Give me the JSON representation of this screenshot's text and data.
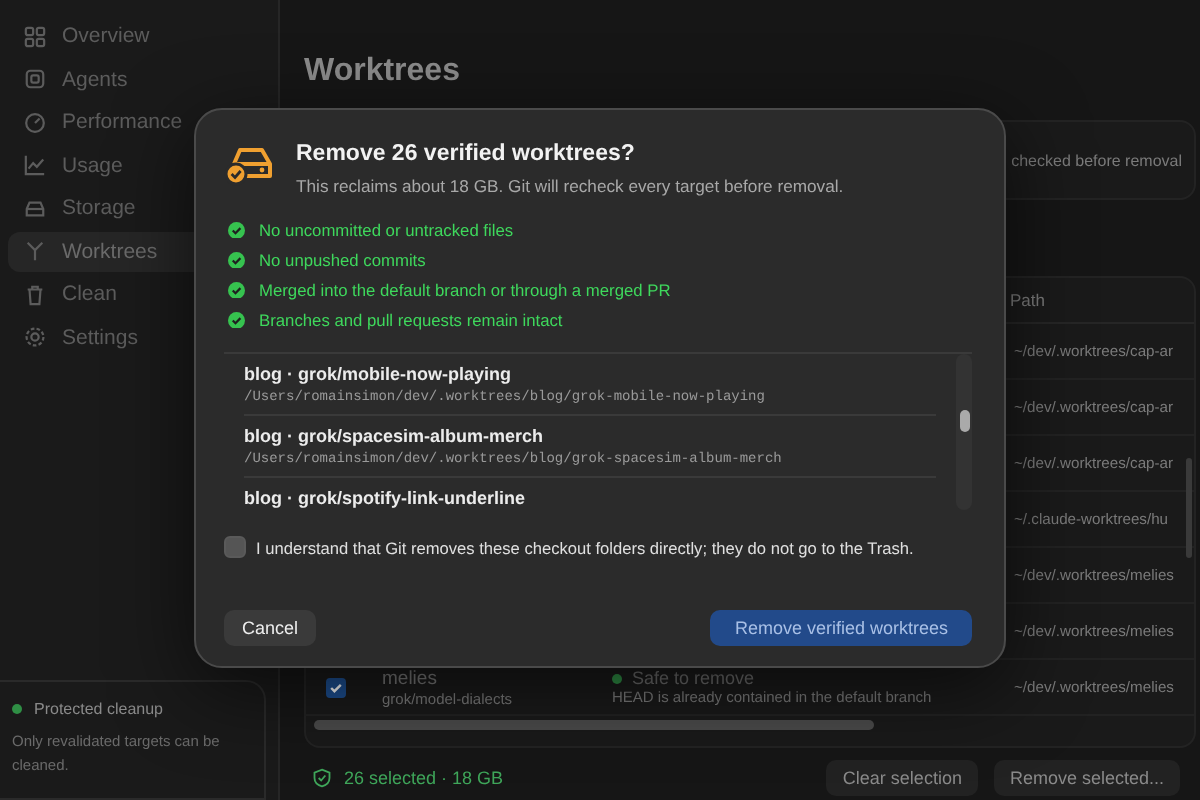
{
  "sidebar": {
    "items": [
      {
        "label": "Overview",
        "selected": false
      },
      {
        "label": "Agents",
        "selected": false
      },
      {
        "label": "Performance",
        "selected": false
      },
      {
        "label": "Usage",
        "selected": false
      },
      {
        "label": "Storage",
        "selected": false
      },
      {
        "label": "Worktrees",
        "selected": true
      },
      {
        "label": "Clean",
        "selected": false
      },
      {
        "label": "Settings",
        "selected": false
      }
    ],
    "footer": {
      "title": "Protected cleanup",
      "text": "Only revalidated targets can be cleaned."
    }
  },
  "page": {
    "title": "Worktrees",
    "info": "checked before removal"
  },
  "table": {
    "columns": [
      "Path"
    ],
    "rows": [
      {
        "path": "~/dev/.worktrees/cap-ar"
      },
      {
        "path": "~/dev/.worktrees/cap-ar"
      },
      {
        "path": "~/dev/.worktrees/cap-ar"
      },
      {
        "path": "~/.claude-worktrees/hu"
      },
      {
        "path": "~/dev/.worktrees/melies"
      },
      {
        "path": "~/dev/.worktrees/melies"
      },
      {
        "name": "melies",
        "branch": "grok/model-dialects",
        "status": "Safe to remove",
        "detail": "HEAD is already contained in the default branch",
        "path": "~/dev/.worktrees/melies",
        "checked": true
      }
    ]
  },
  "footer": {
    "summary": "26 selected · 18 GB",
    "buttons": [
      "Clear selection",
      "Remove selected..."
    ]
  },
  "dialog": {
    "title": "Remove 26 verified worktrees?",
    "subtitle": "This reclaims about 18 GB. Git will recheck every target before removal.",
    "checks": [
      "No uncommitted or untracked files",
      "No unpushed commits",
      "Merged into the default branch or through a merged PR",
      "Branches and pull requests remain intact"
    ],
    "items": [
      {
        "title": "blog · grok/mobile-now-playing",
        "path": "/Users/romainsimon/dev/.worktrees/blog/grok-mobile-now-playing"
      },
      {
        "title": "blog · grok/spacesim-album-merch",
        "path": "/Users/romainsimon/dev/.worktrees/blog/grok-spacesim-album-merch"
      },
      {
        "title": "blog · grok/spotify-link-underline"
      }
    ],
    "confirm": {
      "label": "I understand that Git removes these checkout folders directly; they do not go to the Trash.",
      "checked": false
    },
    "cancel": "Cancel",
    "primary": {
      "label": "Remove verified worktrees",
      "disabled": true
    }
  }
}
